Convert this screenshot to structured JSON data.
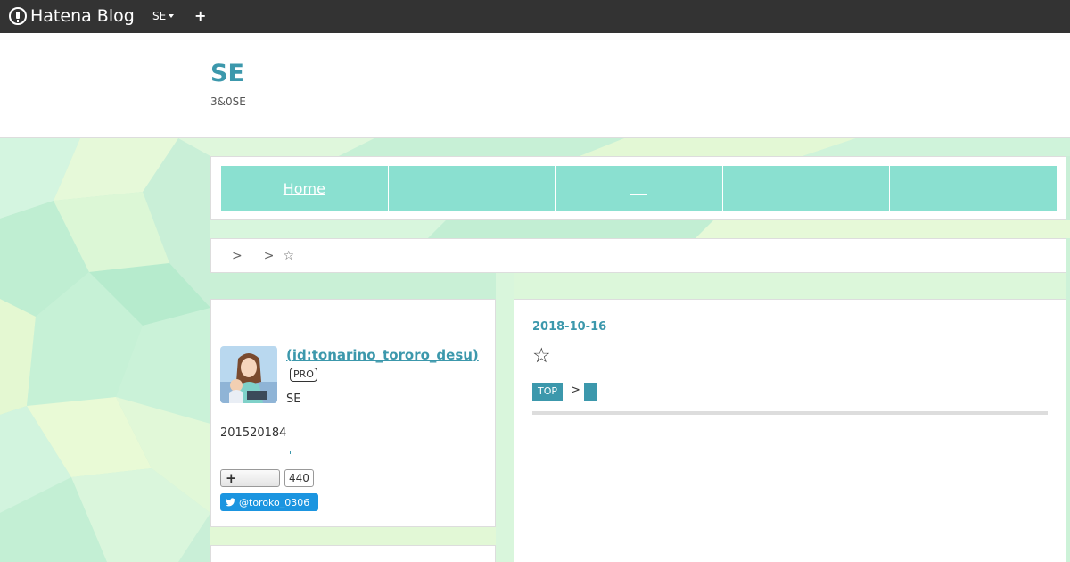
{
  "globalbar": {
    "brand": "Hatena Blog",
    "menu_label": "SE",
    "plus_label": "+"
  },
  "header": {
    "title": "SE",
    "description": "3&0SE"
  },
  "nav": {
    "items": [
      {
        "label": "Home"
      },
      {
        "label": ""
      },
      {
        "label": ""
      },
      {
        "label": ""
      },
      {
        "label": ""
      }
    ]
  },
  "breadcrumb": {
    "separator": ">",
    "current": "☆"
  },
  "sidebar": {
    "profile_name": "(id:tonarino_tororo_desu)",
    "pro_label": "PRO",
    "profile_text": "SE",
    "count_text": "201520184",
    "follow_label": "+",
    "follow_count": "440",
    "twitter_label": "@toroko_0306"
  },
  "entry": {
    "date": "2018-10-16",
    "title": "☆",
    "tag_top": "TOP",
    "tag_sep": ">"
  },
  "colors": {
    "accent": "#3c98ac",
    "nav_bg": "#8ae0d0",
    "globalbar": "#333333",
    "twitter": "#1b95e0"
  }
}
